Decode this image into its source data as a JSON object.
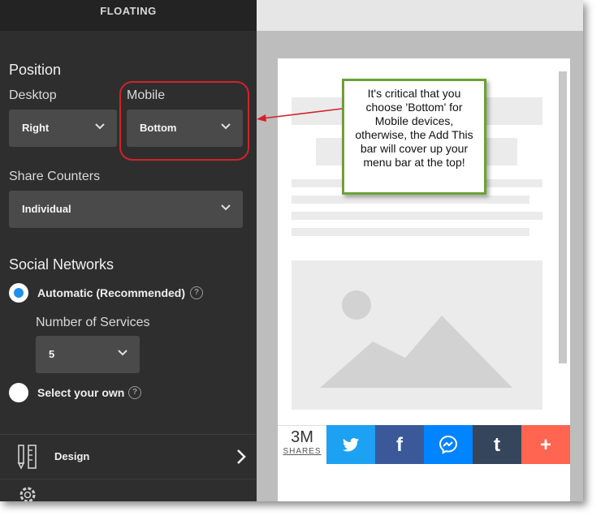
{
  "panel": {
    "header_title": "FLOATING",
    "position": {
      "heading": "Position",
      "desktop_label": "Desktop",
      "desktop_value": "Right",
      "mobile_label": "Mobile",
      "mobile_value": "Bottom"
    },
    "share_counters": {
      "label": "Share Counters",
      "value": "Individual"
    },
    "social_networks": {
      "heading": "Social Networks",
      "automatic_label": "Automatic (Recommended)",
      "automatic_selected": true,
      "number_of_services_label": "Number of Services",
      "number_of_services_value": "5",
      "select_own_label": "Select your own",
      "select_own_selected": false,
      "help_glyph": "?"
    },
    "design_label": "Design"
  },
  "preview": {
    "share_count": "3M",
    "share_count_label": "SHARES",
    "buttons": [
      {
        "name": "twitter",
        "glyph": "🐦",
        "color": "#1da1f2"
      },
      {
        "name": "facebook",
        "glyph": "f",
        "color": "#3b5998"
      },
      {
        "name": "messenger",
        "glyph": "⌁",
        "color": "#0084ff"
      },
      {
        "name": "tumblr",
        "glyph": "t",
        "color": "#35465c"
      },
      {
        "name": "more",
        "glyph": "+",
        "color": "#ff6550"
      }
    ]
  },
  "annotation": {
    "text": "It's critical that you choose 'Bottom' for Mobile devices, otherwise, the Add This bar will cover up your menu bar at the top!",
    "border_color": "#6aa234",
    "arrow_color": "#d3222a"
  }
}
